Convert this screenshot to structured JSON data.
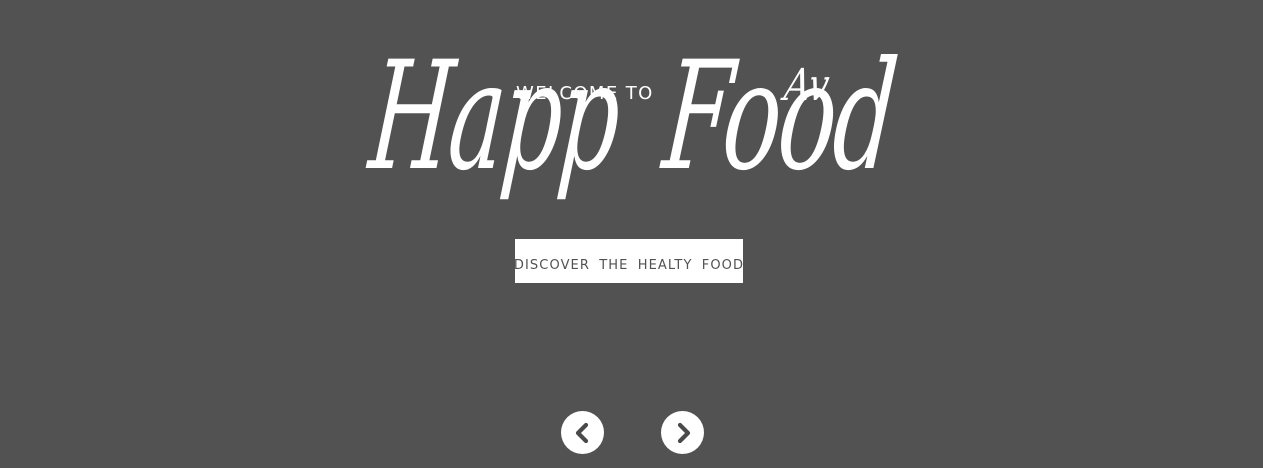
{
  "hero": {
    "welcome_text": "WELCOME TO",
    "brand": {
      "word1": "Happ",
      "superscript": "Av",
      "word2": "Food"
    },
    "cta_label": "DISCOVER THE HEALTY FOOD"
  },
  "slider": {
    "prev_icon": "chevron-left-icon",
    "next_icon": "chevron-right-icon"
  },
  "colors": {
    "background": "#525252",
    "foreground": "#ffffff"
  }
}
